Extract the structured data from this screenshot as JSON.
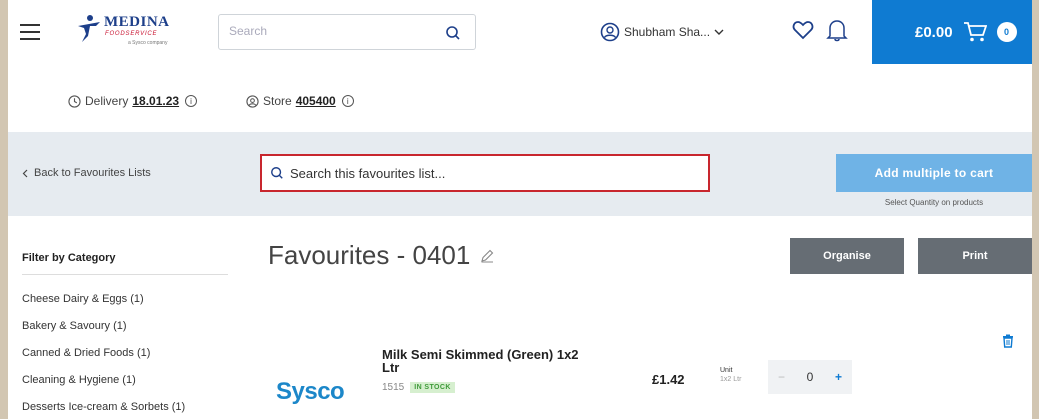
{
  "header": {
    "logo_brand": "MEDINA",
    "logo_sub": "FOODSERVICE",
    "logo_tiny": "a Sysco company",
    "search_placeholder": "Search",
    "user_name": "Shubham Sha...",
    "cart_total": "£0.00",
    "cart_count": "0"
  },
  "delivery_bar": {
    "delivery_label": "Delivery",
    "delivery_date": "18.01.23",
    "store_label": "Store",
    "store_number": "405400"
  },
  "favourites_bar": {
    "back_label": "Back to Favourites Lists",
    "search_placeholder": "Search this favourites list...",
    "add_multiple_label": "Add multiple to cart",
    "add_multiple_hint": "Select Quantity on products"
  },
  "sidebar": {
    "filter_title": "Filter by Category",
    "categories": [
      "Cheese Dairy & Eggs (1)",
      "Bakery & Savoury (1)",
      "Canned & Dried Foods (1)",
      "Cleaning & Hygiene (1)",
      "Desserts Ice-cream & Sorbets (1)"
    ]
  },
  "main": {
    "list_title": "Favourites - 0401",
    "organise_label": "Organise",
    "print_label": "Print"
  },
  "products": [
    {
      "brand_logo": "Sysco",
      "name": "Milk Semi Skimmed (Green) 1x2 Ltr",
      "code": "1515",
      "stock": "IN STOCK",
      "price": "£1.42",
      "unit_label": "Unit",
      "unit_size": "1x2 Ltr",
      "quantity": "0",
      "minus": "−",
      "plus": "+"
    }
  ],
  "colors": {
    "accent": "#0f7bd2",
    "band": "#e6ebf0",
    "highlight_border": "#c8262e",
    "button_dark": "#666d74",
    "stock_green": "#3f9a3a"
  }
}
